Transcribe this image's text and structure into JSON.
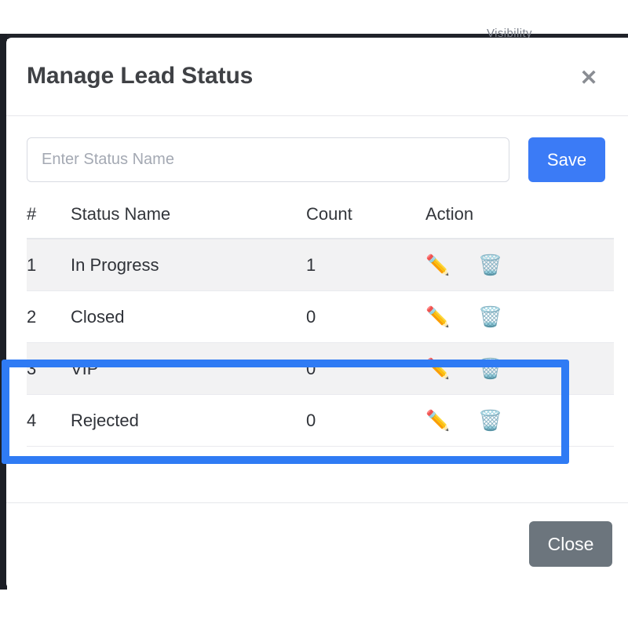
{
  "backdrop": {
    "ghost_text": "Visibility"
  },
  "modal": {
    "title": "Manage Lead Status",
    "close_icon": "close-x-icon",
    "add_status": {
      "placeholder": "Enter Status Name",
      "value": "",
      "save_label": "Save"
    },
    "table": {
      "headers": {
        "num": "#",
        "name": "Status Name",
        "count": "Count",
        "action": "Action"
      },
      "rows": [
        {
          "num": "1",
          "name": "In Progress",
          "count": "1",
          "edit_icon": "✏️",
          "delete_icon": "🗑️"
        },
        {
          "num": "2",
          "name": "Closed",
          "count": "0",
          "edit_icon": "✏️",
          "delete_icon": "🗑️"
        },
        {
          "num": "3",
          "name": "VIP",
          "count": "0",
          "edit_icon": "✏️",
          "delete_icon": "🗑️"
        },
        {
          "num": "4",
          "name": "Rejected",
          "count": "0",
          "edit_icon": "✏️",
          "delete_icon": "🗑️"
        }
      ]
    },
    "footer": {
      "close_label": "Close"
    }
  },
  "annotation": {
    "highlight_color": "#2f7bf4",
    "highlights_rows": [
      "3",
      "4"
    ]
  },
  "colors": {
    "primary": "#3b7bf6",
    "secondary": "#6c757d",
    "highlight": "#2f7bf4",
    "stripe": "#f2f2f3",
    "text": "#2f3238"
  }
}
